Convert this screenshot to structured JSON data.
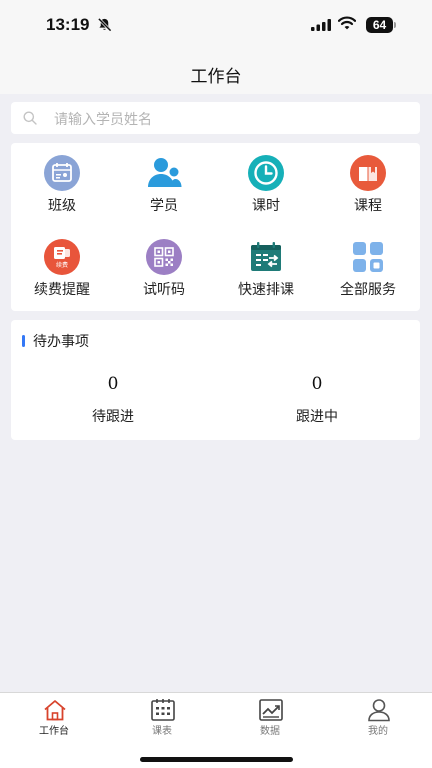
{
  "status_bar": {
    "time": "13:19",
    "battery": "64",
    "icons": [
      "bell-slash-icon",
      "signal-icon",
      "wifi-icon",
      "battery-icon"
    ]
  },
  "nav": {
    "title": "工作台"
  },
  "search": {
    "placeholder": "请输入学员姓名",
    "icon": "search-icon"
  },
  "services": [
    {
      "label": "班级",
      "icon": "class-icon",
      "color": "#8aa4d6"
    },
    {
      "label": "学员",
      "icon": "students-icon",
      "color": "#2b9bdc"
    },
    {
      "label": "课时",
      "icon": "clock-icon",
      "color": "#16b0b8"
    },
    {
      "label": "课程",
      "icon": "course-book-icon",
      "color": "#e85a3b"
    },
    {
      "label": "续费提醒",
      "icon": "renewal-icon",
      "color": "#e8553b",
      "badge": "续费"
    },
    {
      "label": "试听码",
      "icon": "qr-code-icon",
      "color": "#9c7fc4"
    },
    {
      "label": "快速排课",
      "icon": "calendar-schedule-icon",
      "color": "#1f7b78"
    },
    {
      "label": "全部服务",
      "icon": "grid-icon",
      "color": "#7eb2ea"
    }
  ],
  "todo": {
    "title": "待办事项",
    "accent": "#3478f6",
    "items": [
      {
        "count": "0",
        "label": "待跟进"
      },
      {
        "count": "0",
        "label": "跟进中"
      }
    ]
  },
  "tabs": [
    {
      "label": "工作台",
      "icon": "home-icon",
      "active": true,
      "color": "#d8432c"
    },
    {
      "label": "课表",
      "icon": "timetable-icon",
      "active": false
    },
    {
      "label": "数据",
      "icon": "chart-icon",
      "active": false
    },
    {
      "label": "我的",
      "icon": "profile-icon",
      "active": false
    }
  ]
}
